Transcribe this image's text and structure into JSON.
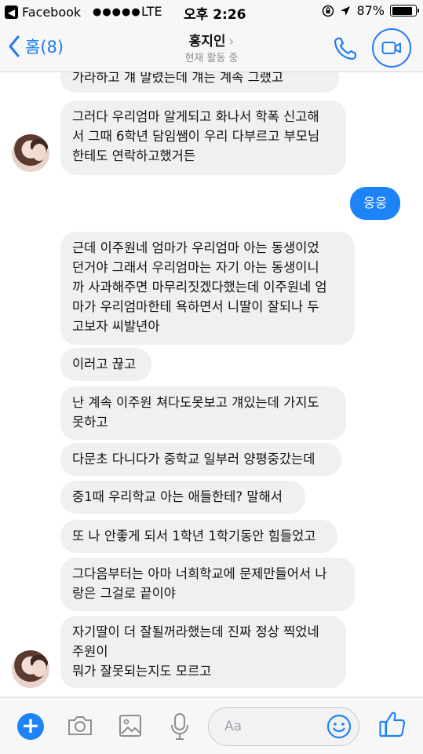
{
  "status_bar": {
    "app_back": "Facebook",
    "signal": "●●●●●",
    "carrier": "LTE",
    "time": "오후 2:26",
    "battery_percent": "87%",
    "battery_level": 0.87
  },
  "header": {
    "back_label": "홈(8)",
    "contact_name": "홍지인",
    "chevron": "›",
    "subtitle": "현재 활동 중",
    "call_icon": "phone-icon",
    "video_icon": "video-camera-icon"
  },
  "messages": [
    {
      "from": "them",
      "text": "가라하고 걔 말렸는데 걔는 계속 그랬고"
    },
    {
      "from": "them",
      "text": "그러다 우리엄마 알게되고 화나서 학폭 신고해\n서 그때 6학년 담임쌤이 우리 다부르고 부모님\n한테도 연락하고했거든"
    },
    {
      "from": "me",
      "text": "웅웅"
    },
    {
      "from": "them",
      "text": "근데 이주원네 엄마가 우리엄마 아는 동생이었\n던거야 그래서 우리엄마는 자기 아는 동생이니\n까 사과해주면 마무리짓겠다했는데 이주원네 엄\n마가 우리엄마한테 욕하면서 니딸이 잘되나 두\n고보자 씨발년아"
    },
    {
      "from": "them",
      "text": "이러고 끊고"
    },
    {
      "from": "them",
      "text": "난 계속 이주원 쳐다도못보고 걔있는데 가지도\n못하고"
    },
    {
      "from": "them",
      "text": "다문초 다니다가 중학교 일부러 양평중갔는데"
    },
    {
      "from": "them",
      "text": "중1때 우리학교 아는 애들한테? 말해서"
    },
    {
      "from": "them",
      "text": "또 나 안좋게 되서 1학년 1학기동안 힘들었고"
    },
    {
      "from": "them",
      "text": "그다음부터는 아마 너희학교에 문제만들어서 나\n랑은 그걸로 끝이야"
    },
    {
      "from": "them",
      "text": "자기딸이 더 잘될꺼라했는데 진짜 정상 찍었네\n주원이\n뭐가 잘못되는지도 모르고"
    }
  ],
  "composer": {
    "placeholder": "Aa",
    "plus_icon": "plus-icon",
    "camera_icon": "camera-icon",
    "image_icon": "image-icon",
    "mic_icon": "microphone-icon",
    "emoji_icon": "emoji-icon",
    "like_icon": "thumbs-up-icon",
    "plus_label": "+"
  },
  "colors": {
    "accent": "#1f7cf2",
    "sent_bubble": "#1f83f8",
    "received_bubble": "#f1f0f0"
  }
}
